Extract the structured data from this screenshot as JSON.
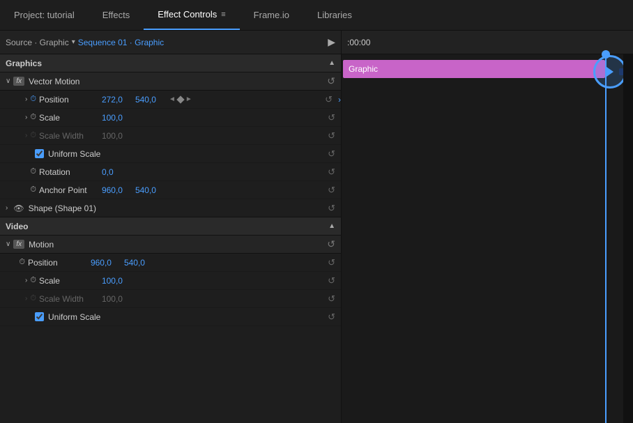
{
  "header": {
    "tabs": [
      {
        "id": "project",
        "label": "Project: tutorial",
        "active": false
      },
      {
        "id": "effects",
        "label": "Effects",
        "active": false
      },
      {
        "id": "effect-controls",
        "label": "Effect Controls",
        "active": true
      },
      {
        "id": "frameio",
        "label": "Frame.io",
        "active": false
      },
      {
        "id": "libraries",
        "label": "Libraries",
        "active": false
      }
    ],
    "menu_icon": "≡"
  },
  "sub_header": {
    "source_label": "Source · Graphic",
    "seq_label": "Sequence 01 · Graphic",
    "play_icon": "▶"
  },
  "sections": {
    "graphics": {
      "label": "Graphics",
      "collapse_icon": "▲",
      "effects": [
        {
          "label": "Vector Motion",
          "properties": [
            {
              "name": "Position",
              "values": [
                "272,0",
                "540,0"
              ],
              "has_stopwatch": true,
              "stopwatch_active": true,
              "has_nav": true,
              "indent": 2
            },
            {
              "name": "Scale",
              "values": [
                "100,0"
              ],
              "has_stopwatch": true,
              "stopwatch_active": false,
              "indent": 2
            },
            {
              "name": "Scale Width",
              "values": [
                "100,0"
              ],
              "has_stopwatch": false,
              "dimmed": true,
              "indent": 2
            },
            {
              "type": "checkbox",
              "label": "Uniform Scale",
              "checked": true
            },
            {
              "name": "Rotation",
              "values": [
                "0,0"
              ],
              "has_stopwatch": true,
              "stopwatch_active": false,
              "indent": 2
            },
            {
              "name": "Anchor Point",
              "values": [
                "960,0",
                "540,0"
              ],
              "has_stopwatch": true,
              "stopwatch_active": false,
              "indent": 2
            }
          ]
        }
      ],
      "shape": {
        "label": "Shape (Shape 01)"
      }
    },
    "video": {
      "label": "Video",
      "effects": [
        {
          "label": "Motion",
          "properties": [
            {
              "name": "Position",
              "values": [
                "960,0",
                "540,0"
              ],
              "has_stopwatch": true,
              "stopwatch_active": false,
              "indent": 2
            },
            {
              "name": "Scale",
              "values": [
                "100,0"
              ],
              "has_stopwatch": true,
              "stopwatch_active": false,
              "indent": 2
            },
            {
              "name": "Scale Width",
              "values": [
                "100,0"
              ],
              "has_stopwatch": false,
              "dimmed": true,
              "indent": 2
            },
            {
              "type": "checkbox",
              "label": "Uniform Scale",
              "checked": true
            }
          ]
        }
      ]
    }
  },
  "timeline": {
    "timecode": ":00:00",
    "clip_label": "Graphic",
    "clip_color": "#c864c8"
  }
}
